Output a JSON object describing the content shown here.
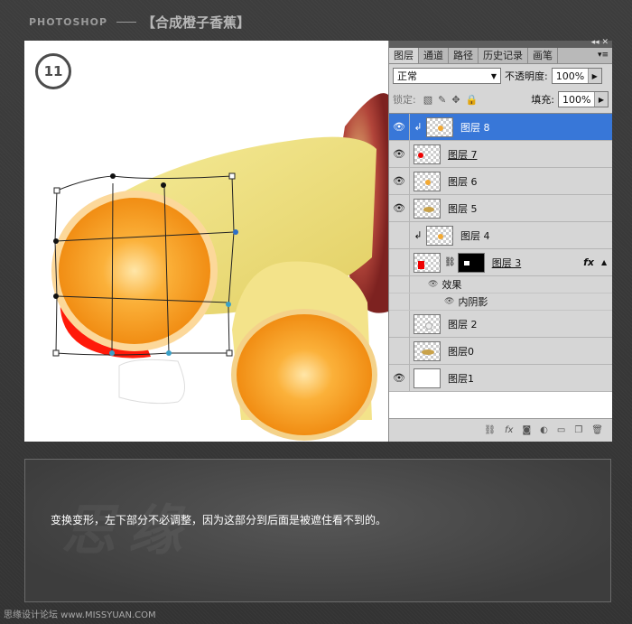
{
  "header": {
    "brand": "PHOTOSHOP",
    "title": "【合成橙子香蕉】"
  },
  "canvas": {
    "step_number": "11"
  },
  "panel": {
    "tabs": [
      "图层",
      "通道",
      "路径",
      "历史记录",
      "画笔"
    ],
    "menu_icon": "panel-menu-icon",
    "blend_mode": "正常",
    "opacity_label": "不透明度:",
    "opacity_value": "100%",
    "lock_label": "锁定:",
    "fill_label": "填充:",
    "fill_value": "100%",
    "layers": [
      {
        "name": "图层 8",
        "visible": true,
        "selected": true,
        "clipped": true
      },
      {
        "name": "图层 7",
        "visible": true
      },
      {
        "name": "图层 6",
        "visible": true
      },
      {
        "name": "图层 5",
        "visible": true
      },
      {
        "name": "图层 4",
        "visible": false,
        "clipped": true
      },
      {
        "name": "图层 3",
        "visible": false,
        "has_mask": true,
        "fx": "fx"
      },
      {
        "name": "效果"
      },
      {
        "name": "内阴影"
      },
      {
        "name": "图层 2",
        "visible": false
      },
      {
        "name": "图层0",
        "visible": false
      },
      {
        "name": "图层1",
        "visible": true
      }
    ]
  },
  "info": {
    "caption": "变换变形，左下部分不必调整，因为这部分到后面是被遮住看不到的。"
  },
  "footer": {
    "text": "思缘设计论坛 www.MISSYUAN.COM"
  }
}
